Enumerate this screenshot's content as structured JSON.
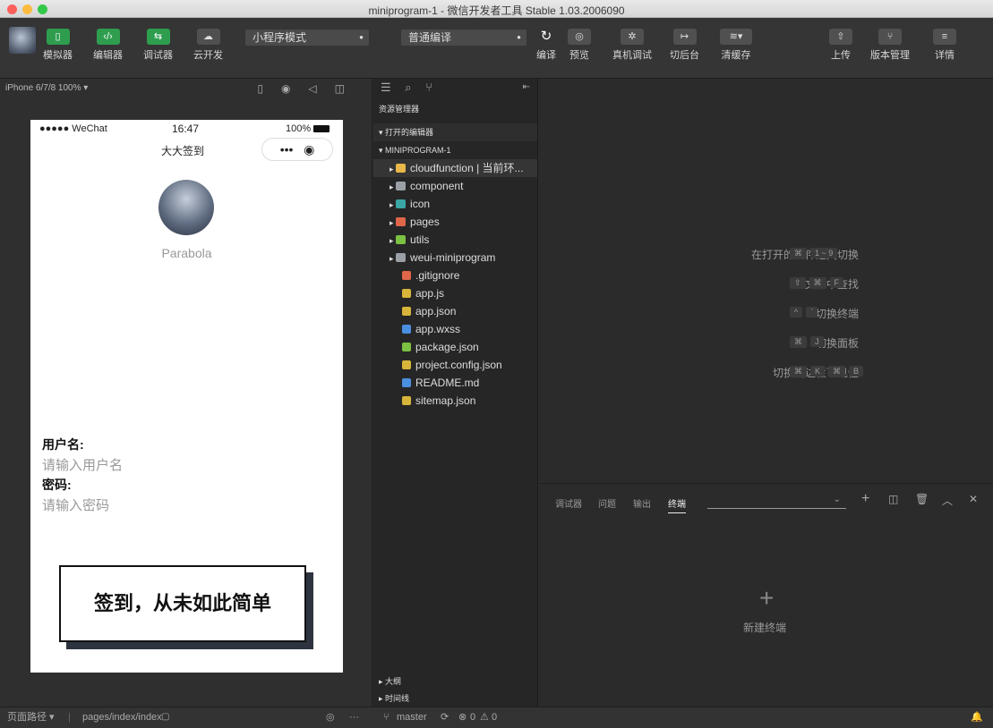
{
  "window": {
    "title": "miniprogram-1 - 微信开发者工具 Stable 1.03.2006090"
  },
  "toolbar": {
    "simulator": "模拟器",
    "editor": "编辑器",
    "debugger": "调试器",
    "cloud": "云开发",
    "mode": "小程序模式",
    "compile_mode": "普通编译",
    "compile": "编译",
    "preview": "预览",
    "remote_debug": "真机调试",
    "background": "切后台",
    "clear_cache": "清缓存",
    "upload": "上传",
    "version": "版本管理",
    "details": "详情"
  },
  "simulator": {
    "device": "iPhone 6/7/8 100% ▾",
    "carrier": "●●●●● WeChat",
    "time": "16:47",
    "battery": "100%",
    "nav_title": "大大签到",
    "username": "Parabola",
    "user_label": "用户名:",
    "user_placeholder": "请输入用户名",
    "pass_label": "密码:",
    "pass_placeholder": "请输入密码",
    "signin_text": "签到，从未如此简单"
  },
  "explorer": {
    "title": "资源管理器",
    "open_editors": "▾ 打开的编辑器",
    "project": "▾ MINIPROGRAM-1",
    "items": [
      {
        "name": "cloudfunction | 当前环...",
        "folder": true,
        "color": "#e8b84a"
      },
      {
        "name": "component",
        "folder": true,
        "color": "#9aa0a6"
      },
      {
        "name": "icon",
        "folder": true,
        "color": "#3aa6a6"
      },
      {
        "name": "pages",
        "folder": true,
        "color": "#e0664a"
      },
      {
        "name": "utils",
        "folder": true,
        "color": "#7cc142"
      },
      {
        "name": "weui-miniprogram",
        "folder": true,
        "color": "#9aa0a6"
      },
      {
        "name": ".gitignore",
        "folder": false,
        "color": "#e0664a"
      },
      {
        "name": "app.js",
        "folder": false,
        "color": "#d7b53a"
      },
      {
        "name": "app.json",
        "folder": false,
        "color": "#d7b53a"
      },
      {
        "name": "app.wxss",
        "folder": false,
        "color": "#4a8fe0"
      },
      {
        "name": "package.json",
        "folder": false,
        "color": "#7cc142"
      },
      {
        "name": "project.config.json",
        "folder": false,
        "color": "#d7b53a"
      },
      {
        "name": "README.md",
        "folder": false,
        "color": "#4a8fe0"
      },
      {
        "name": "sitemap.json",
        "folder": false,
        "color": "#d7b53a"
      }
    ],
    "outline": "▸ 大纲",
    "timeline": "▸ 时间线"
  },
  "editor": {
    "hints": [
      {
        "label": "在打开的文件之间切换",
        "keys": [
          "⌘",
          "1 ~ 9"
        ]
      },
      {
        "label": "在文件中查找",
        "keys": [
          "⇧",
          "⌘",
          "F"
        ]
      },
      {
        "label": "切换终端",
        "keys": [
          "^",
          "`"
        ]
      },
      {
        "label": "切换面板",
        "keys": [
          "⌘",
          "J"
        ]
      },
      {
        "label": "切换侧边栏可见性",
        "keys": [
          "⌘",
          "K",
          "⌘",
          "B"
        ]
      }
    ]
  },
  "terminal": {
    "tabs": [
      "调试器",
      "问题",
      "输出",
      "终端"
    ],
    "new_terminal": "新建终端"
  },
  "status": {
    "path_label": "页面路径 ▾",
    "path": "pages/index/index",
    "branch": "master",
    "errors": "0",
    "warnings": "0"
  },
  "colors": {
    "accent_green": "#2e9d4e",
    "bg": "#2b2b2b"
  }
}
